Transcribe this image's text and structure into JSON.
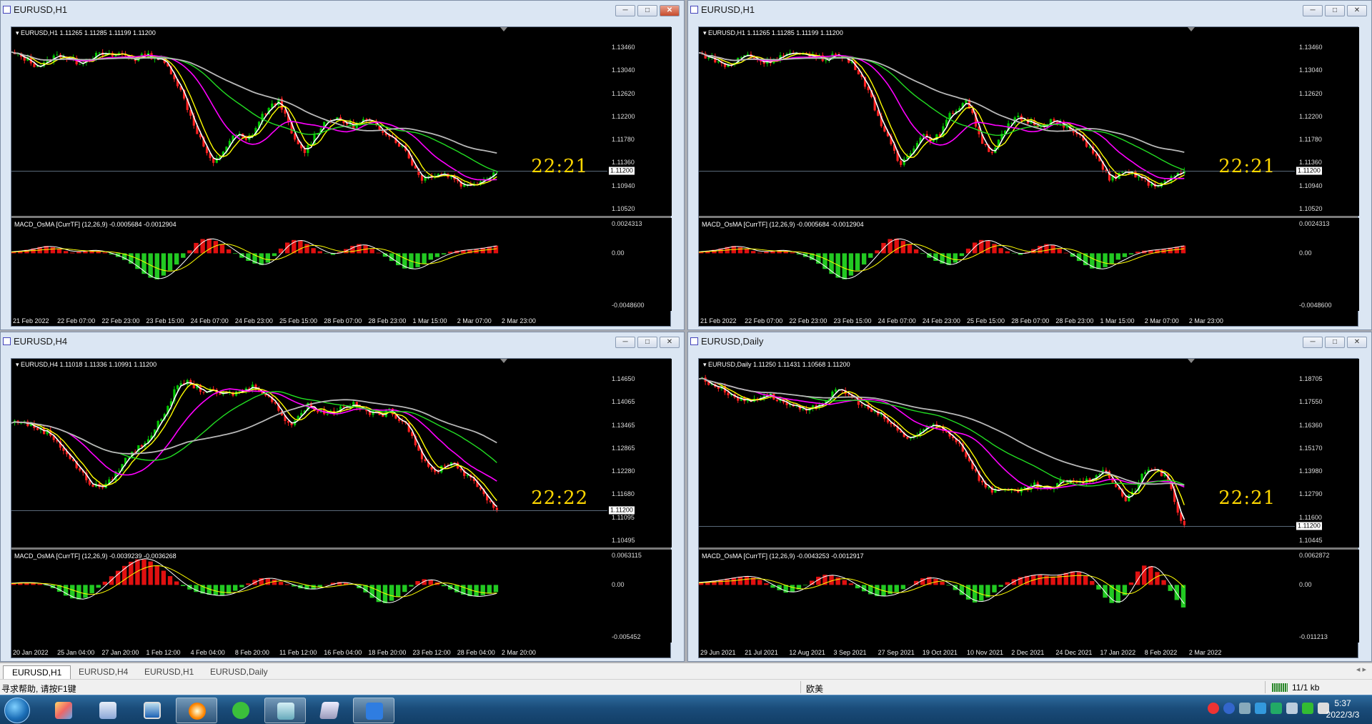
{
  "colors": {
    "bull": "#00c800",
    "bear": "#ff2020",
    "ma_fast": "#ffffff",
    "ma_yellow": "#ffff00",
    "ma_magenta": "#ff00ff",
    "ma_green": "#22dd22",
    "ma_gray": "#b8b8b8",
    "clock": "#ffd700"
  },
  "windows": [
    {
      "title": "EURUSD,H1",
      "icon": "chart-window-icon",
      "symbol_line": "EURUSD,H1  1.11265 1.11285 1.11199 1.11200",
      "clock": "22:21",
      "price_ticks": [
        "1.13460",
        "1.13040",
        "1.12620",
        "1.12200",
        "1.11780",
        "1.11360",
        "1.10940",
        "1.10520"
      ],
      "current_price": "1.11200",
      "macd_label": "MACD_OsMA [CurrTF] (12,26,9) -0.0005684 -0.0012904",
      "macd_ticks": [
        "0.0024313",
        "0.00",
        "-0.0048600"
      ],
      "time_ticks": [
        "21 Feb 2022",
        "22 Feb 07:00",
        "22 Feb 23:00",
        "23 Feb 15:00",
        "24 Feb 07:00",
        "24 Feb 23:00",
        "25 Feb 15:00",
        "28 Feb 07:00",
        "28 Feb 23:00",
        "1 Mar 15:00",
        "2 Mar 07:00",
        "2 Mar 23:00"
      ],
      "active": true
    },
    {
      "title": "EURUSD,H1",
      "icon": "chart-window-icon",
      "symbol_line": "EURUSD,H1  1.11265 1.11285 1.11199 1.11200",
      "clock": "22:21",
      "price_ticks": [
        "1.13460",
        "1.13040",
        "1.12620",
        "1.12200",
        "1.11780",
        "1.11360",
        "1.10940",
        "1.10520"
      ],
      "current_price": "1.11200",
      "macd_label": "MACD_OsMA [CurrTF] (12,26,9) -0.0005684 -0.0012904",
      "macd_ticks": [
        "0.0024313",
        "0.00",
        "-0.0048600"
      ],
      "time_ticks": [
        "21 Feb 2022",
        "22 Feb 07:00",
        "22 Feb 23:00",
        "23 Feb 15:00",
        "24 Feb 07:00",
        "24 Feb 23:00",
        "25 Feb 15:00",
        "28 Feb 07:00",
        "28 Feb 23:00",
        "1 Mar 15:00",
        "2 Mar 07:00",
        "2 Mar 23:00"
      ],
      "active": false
    },
    {
      "title": "EURUSD,H4",
      "icon": "chart-window-icon",
      "symbol_line": "EURUSD,H4  1.11018 1.11336 1.10991 1.11200",
      "clock": "22:22",
      "price_ticks": [
        "1.14650",
        "1.14065",
        "1.13465",
        "1.12865",
        "1.12280",
        "1.11680",
        "1.11095",
        "1.10495"
      ],
      "current_price": "1.11200",
      "macd_label": "MACD_OsMA [CurrTF] (12,26,9) -0.0039239 -0.0036268",
      "macd_ticks": [
        "0.0063115",
        "0.00",
        "-0.005452"
      ],
      "time_ticks": [
        "20 Jan 2022",
        "25 Jan 04:00",
        "27 Jan 20:00",
        "1 Feb 12:00",
        "4 Feb 04:00",
        "8 Feb 20:00",
        "11 Feb 12:00",
        "16 Feb 04:00",
        "18 Feb 20:00",
        "23 Feb 12:00",
        "28 Feb 04:00",
        "2 Mar 20:00"
      ],
      "active": false
    },
    {
      "title": "EURUSD,Daily",
      "icon": "chart-window-icon",
      "symbol_line": "EURUSD,Daily  1.11250 1.11431 1.10568 1.11200",
      "clock": "22:21",
      "price_ticks": [
        "1.18705",
        "1.17550",
        "1.16360",
        "1.15170",
        "1.13980",
        "1.12790",
        "1.11600",
        "1.10445"
      ],
      "current_price": "1.11200",
      "macd_label": "MACD_OsMA [CurrTF] (12,26,9) -0.0043253 -0.0012917",
      "macd_ticks": [
        "0.0062872",
        "0.00",
        "-0.011213"
      ],
      "time_ticks": [
        "29 Jun 2021",
        "21 Jul 2021",
        "12 Aug 2021",
        "3 Sep 2021",
        "27 Sep 2021",
        "19 Oct 2021",
        "10 Nov 2021",
        "2 Dec 2021",
        "24 Dec 2021",
        "17 Jan 2022",
        "8 Feb 2022",
        "2 Mar 2022"
      ],
      "active": false
    }
  ],
  "chart_data": [
    {
      "type": "candlestick",
      "title": "EURUSD,H1",
      "price_range": [
        1.1045,
        1.137
      ],
      "close_path": [
        1.1342,
        1.1336,
        1.133,
        1.1318,
        1.1322,
        1.1335,
        1.134,
        1.133,
        1.1325,
        1.1332,
        1.1338,
        1.134,
        1.1337,
        1.1342,
        1.1335,
        1.133,
        1.134,
        1.1335,
        1.1328,
        1.131,
        1.128,
        1.124,
        1.12,
        1.1165,
        1.113,
        1.115,
        1.1175,
        1.119,
        1.1175,
        1.1195,
        1.1225,
        1.124,
        1.1255,
        1.121,
        1.117,
        1.1155,
        1.118,
        1.1205,
        1.122,
        1.1215,
        1.121,
        1.1205,
        1.1215,
        1.121,
        1.12,
        1.119,
        1.1175,
        1.116,
        1.113,
        1.1105,
        1.111,
        1.1115,
        1.1112,
        1.1105,
        1.109,
        1.1095,
        1.11,
        1.111,
        1.112
      ],
      "macd_hist": [
        0.2,
        0.4,
        0.6,
        0.9,
        1.1,
        0.8,
        0.4,
        0.1,
        0.3,
        0.5,
        0.4,
        0.1,
        -0.3,
        -0.8,
        -1.5,
        -2.5,
        -3.4,
        -3.9,
        -3.2,
        -2.2,
        -1.0,
        0.4,
        1.8,
        2.3,
        1.9,
        1.2,
        0.3,
        -0.5,
        -1.1,
        -1.6,
        -1.8,
        -0.6,
        0.8,
        1.9,
        2.0,
        1.4,
        0.6,
        0.1,
        -0.3,
        0.2,
        0.8,
        1.4,
        1.2,
        0.5,
        -0.2,
        -1.0,
        -1.8,
        -2.4,
        -2.2,
        -1.6,
        -0.8,
        -0.4,
        0.2,
        0.4,
        0.5,
        0.6,
        0.8,
        1.0,
        1.2
      ],
      "macd_ylim": [
        -0.00486,
        0.0024313
      ]
    },
    {
      "type": "candlestick",
      "title": "EURUSD,H1",
      "price_range": [
        1.1045,
        1.137
      ],
      "close_path": [
        1.1342,
        1.1336,
        1.133,
        1.1318,
        1.1322,
        1.1335,
        1.134,
        1.133,
        1.1325,
        1.1332,
        1.1338,
        1.134,
        1.1337,
        1.1342,
        1.1335,
        1.133,
        1.134,
        1.1335,
        1.1328,
        1.131,
        1.128,
        1.124,
        1.12,
        1.1165,
        1.113,
        1.115,
        1.1175,
        1.119,
        1.1175,
        1.1195,
        1.1225,
        1.124,
        1.1255,
        1.121,
        1.117,
        1.1155,
        1.118,
        1.1205,
        1.122,
        1.1215,
        1.121,
        1.1205,
        1.1215,
        1.121,
        1.12,
        1.119,
        1.1175,
        1.116,
        1.113,
        1.1105,
        1.111,
        1.1115,
        1.1112,
        1.1105,
        1.109,
        1.1095,
        1.11,
        1.111,
        1.112
      ],
      "macd_hist": [
        0.2,
        0.4,
        0.6,
        0.9,
        1.1,
        0.8,
        0.4,
        0.1,
        0.3,
        0.5,
        0.4,
        0.1,
        -0.3,
        -0.8,
        -1.5,
        -2.5,
        -3.4,
        -3.9,
        -3.2,
        -2.2,
        -1.0,
        0.4,
        1.8,
        2.3,
        1.9,
        1.2,
        0.3,
        -0.5,
        -1.1,
        -1.6,
        -1.8,
        -0.6,
        0.8,
        1.9,
        2.0,
        1.4,
        0.6,
        0.1,
        -0.3,
        0.2,
        0.8,
        1.4,
        1.2,
        0.5,
        -0.2,
        -1.0,
        -1.8,
        -2.4,
        -2.2,
        -1.6,
        -0.8,
        -0.4,
        0.2,
        0.4,
        0.5,
        0.6,
        0.8,
        1.0,
        1.2
      ],
      "macd_ylim": [
        -0.00486,
        0.0024313
      ]
    },
    {
      "type": "candlestick",
      "title": "EURUSD,H4",
      "price_range": [
        1.104,
        1.148
      ],
      "close_path": [
        1.1345,
        1.135,
        1.134,
        1.133,
        1.132,
        1.13,
        1.127,
        1.124,
        1.121,
        1.1185,
        1.118,
        1.1195,
        1.123,
        1.126,
        1.128,
        1.13,
        1.133,
        1.137,
        1.142,
        1.145,
        1.1445,
        1.143,
        1.1425,
        1.142,
        1.1418,
        1.1422,
        1.143,
        1.144,
        1.1425,
        1.14,
        1.137,
        1.134,
        1.1365,
        1.139,
        1.138,
        1.137,
        1.1375,
        1.139,
        1.1392,
        1.138,
        1.137,
        1.1365,
        1.1375,
        1.136,
        1.134,
        1.129,
        1.124,
        1.1215,
        1.1235,
        1.1245,
        1.1225,
        1.12,
        1.118,
        1.115,
        1.112
      ],
      "macd_hist": [
        0.3,
        0.5,
        0.4,
        0.2,
        -0.3,
        -1.2,
        -2.2,
        -2.8,
        -2.4,
        -1.2,
        0.4,
        1.8,
        3.2,
        4.3,
        4.9,
        4.6,
        3.6,
        2.2,
        0.8,
        -0.4,
        -1.2,
        -1.6,
        -1.9,
        -2.0,
        -1.6,
        -0.8,
        0.2,
        1.1,
        1.4,
        1.0,
        0.4,
        -0.2,
        -0.7,
        -0.9,
        -0.5,
        0.2,
        0.6,
        0.4,
        -0.2,
        -1.2,
        -2.6,
        -3.6,
        -3.0,
        -2.0,
        -0.6,
        0.8,
        1.2,
        0.6,
        -0.4,
        -1.2,
        -1.8,
        -2.2,
        -2.0,
        -1.6,
        -1.2
      ],
      "macd_ylim": [
        -0.005452,
        0.0063115
      ]
    },
    {
      "type": "candlestick",
      "title": "EURUSD,Daily",
      "price_range": [
        1.104,
        1.192
      ],
      "close_path": [
        1.188,
        1.186,
        1.184,
        1.182,
        1.179,
        1.177,
        1.176,
        1.178,
        1.18,
        1.178,
        1.176,
        1.174,
        1.172,
        1.17,
        1.174,
        1.176,
        1.18,
        1.182,
        1.179,
        1.176,
        1.173,
        1.17,
        1.168,
        1.164,
        1.16,
        1.157,
        1.159,
        1.161,
        1.164,
        1.162,
        1.159,
        1.155,
        1.148,
        1.14,
        1.133,
        1.13,
        1.132,
        1.13,
        1.129,
        1.131,
        1.133,
        1.132,
        1.13,
        1.134,
        1.136,
        1.135,
        1.134,
        1.137,
        1.14,
        1.138,
        1.132,
        1.125,
        1.13,
        1.138,
        1.142,
        1.14,
        1.136,
        1.122,
        1.112
      ],
      "macd_hist": [
        0.4,
        0.6,
        0.8,
        1.0,
        1.2,
        1.4,
        1.5,
        1.1,
        0.6,
        -0.4,
        -0.9,
        -1.4,
        -1.1,
        -0.4,
        0.6,
        1.4,
        1.8,
        1.5,
        1.0,
        0.4,
        -0.6,
        -1.2,
        -1.8,
        -2.0,
        -1.6,
        -1.2,
        -0.6,
        0.4,
        1.0,
        1.4,
        1.0,
        0.4,
        -0.4,
        -1.4,
        -2.4,
        -3.0,
        -2.6,
        -1.8,
        -0.6,
        0.4,
        1.0,
        1.4,
        1.6,
        1.8,
        1.6,
        1.4,
        1.8,
        2.2,
        2.4,
        1.6,
        0.6,
        -1.2,
        -2.8,
        -3.4,
        -2.0,
        0.6,
        2.8,
        3.6,
        2.6,
        1.0,
        -1.2,
        -3.0,
        -4.4
      ],
      "macd_ylim": [
        -0.011213,
        0.0062872
      ]
    }
  ],
  "tabs": [
    "EURUSD,H1",
    "EURUSD,H4",
    "EURUSD,H1",
    "EURUSD,Daily"
  ],
  "status": {
    "help": "寻求帮助, 请按F1键",
    "profile": "欧美",
    "connection": "11/1 kb"
  },
  "taskbar": {
    "time": "5:37",
    "date": "2022/3/3",
    "apps": [
      "start-button",
      "paint-app",
      "contacts-app",
      "display-app",
      "orange-app",
      "wechat-app",
      "mt4-app",
      "notes-app",
      "pen-app"
    ]
  }
}
